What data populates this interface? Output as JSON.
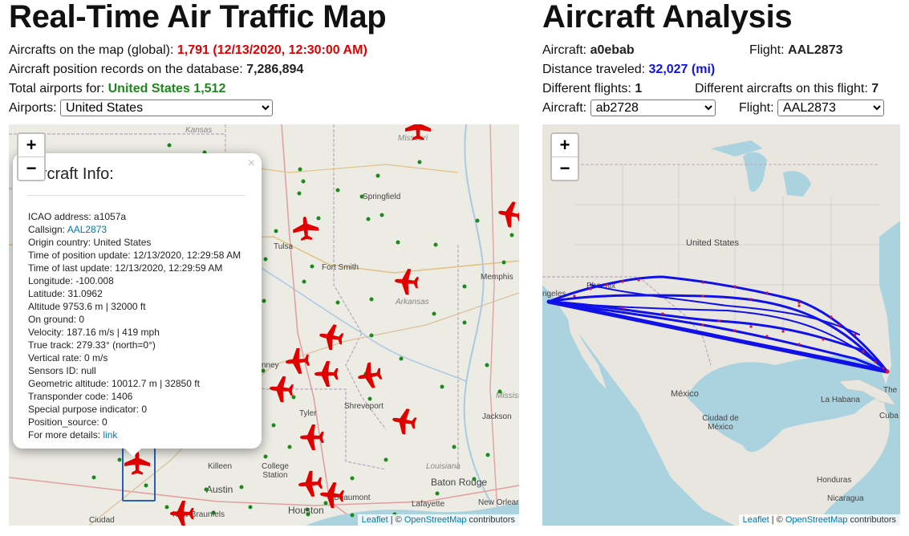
{
  "left": {
    "title": "Real-Time Air Traffic Map",
    "aircraft_global_label": "Aircrafts on the map (global): ",
    "aircraft_global_value": "1,791 (12/13/2020, 12:30:00 AM)",
    "records_label": "Aircraft position records on the database: ",
    "records_value": "7,286,894",
    "airports_label": "Total airports for: ",
    "airports_value": "United States 1,512",
    "airports_select_label": "Airports: ",
    "airports_selected": "United States"
  },
  "right": {
    "title": "Aircraft Analysis",
    "aircraft_label": "Aircraft: ",
    "aircraft_value": "a0ebab",
    "flight_label": "Flight: ",
    "flight_value": "AAL2873",
    "distance_label": "Distance traveled: ",
    "distance_value": "32,027 (mi)",
    "diff_flights_label": "Different flights: ",
    "diff_flights_value": "1",
    "diff_aircrafts_label": "Different aircrafts on this flight: ",
    "diff_aircrafts_value": "7",
    "aircraft_select_label": "Aircraft: ",
    "aircraft_selected": "ab2728",
    "flight_select_label": "Flight: ",
    "flight_selected": "AAL2873"
  },
  "map_controls": {
    "zoom_in": "+",
    "zoom_out": "−"
  },
  "attribution": {
    "leaflet": "Leaflet",
    "sep": " | © ",
    "osm": "OpenStreetMap",
    "contrib": " contributors"
  },
  "popup": {
    "title": "Aircraft Info:",
    "close": "×",
    "icao": "ICAO address: a1057a",
    "callsign_label": "Callsign: ",
    "callsign": "AAL2873",
    "origin": "Origin country: United States",
    "time_pos": "Time of position update: 12/13/2020, 12:29:58 AM",
    "time_last": "Time of last update: 12/13/2020, 12:29:59 AM",
    "longitude": "Longitude: -100.008",
    "latitude": "Latitude: 31.0962",
    "altitude": "Altitude 9753.6 m | 32000 ft",
    "on_ground": "On ground: 0",
    "velocity": "Velocity: 187.16 m/s | 419 mph",
    "true_track": "True track: 279.33° (north=0°)",
    "vertical_rate": "Vertical rate: 0 m/s",
    "sensors": "Sensors ID: null",
    "geo_alt": "Geometric altitude: 10012.7 m | 32850 ft",
    "transponder": "Transponder code: 1406",
    "spi": "Special purpose indicator: 0",
    "pos_source": "Position_source: 0",
    "details_label": "For more details: ",
    "details_link": "link"
  },
  "left_map_labels": [
    "Kansas",
    "Missouri",
    "Springfield",
    "Tulsa",
    "Fort Smith",
    "Arkansas",
    "Memphis",
    "Shreveport",
    "Tyler",
    "Jackson",
    "Killeen",
    "College Station",
    "Austin",
    "Houston",
    "Beaumont",
    "Lafayette",
    "Baton Rouge",
    "New Orleans",
    "Louisiana",
    "Mississ",
    "New Braunfels",
    "Ciudad",
    "nney"
  ],
  "right_map_labels": [
    "United States",
    "Phoenix",
    "ngeles",
    "México",
    "Ciudad de México",
    "La Habana",
    "Cuba",
    "The",
    "Honduras",
    "Nicaragua"
  ],
  "colors": {
    "plane": "#e00000",
    "airport": "#1a8a1a",
    "track": "#1010e8",
    "track_dot": "#e01030"
  }
}
